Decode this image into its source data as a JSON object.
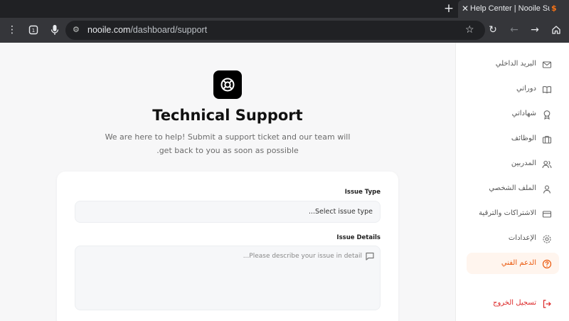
{
  "browser": {
    "tab_title": "Help Center | Nooile Support",
    "url_host": "nooile.com",
    "url_path": "/dashboard/support"
  },
  "support": {
    "title": "Technical Support",
    "subtitle": "We are here to help! Submit a support ticket and our team will get back to you as soon as possible.",
    "issue_type_label": "Issue Type",
    "issue_type_value": "Select issue type...",
    "issue_details_label": "Issue Details",
    "issue_details_placeholder": "Please describe your issue in detail..."
  },
  "sidebar": {
    "items": [
      {
        "label": "البريد الداخلي",
        "icon": "mail-icon"
      },
      {
        "label": "دوراتي",
        "icon": "book-icon"
      },
      {
        "label": "شهاداتي",
        "icon": "award-icon"
      },
      {
        "label": "الوظائف",
        "icon": "briefcase-icon"
      },
      {
        "label": "المدربين",
        "icon": "users-icon"
      },
      {
        "label": "الملف الشخصي",
        "icon": "user-icon"
      },
      {
        "label": "الاشتراكات والترقية",
        "icon": "credit-card-icon"
      },
      {
        "label": "الإعدادات",
        "icon": "settings-icon"
      },
      {
        "label": "الدعم الفني",
        "icon": "help-circle-icon"
      }
    ],
    "logout_label": "تسجيل الخروج"
  },
  "colors": {
    "accent": "#ea580c",
    "active_bg": "#fff5ee",
    "logout": "#dc2626",
    "chrome_bg": "#35363a"
  }
}
